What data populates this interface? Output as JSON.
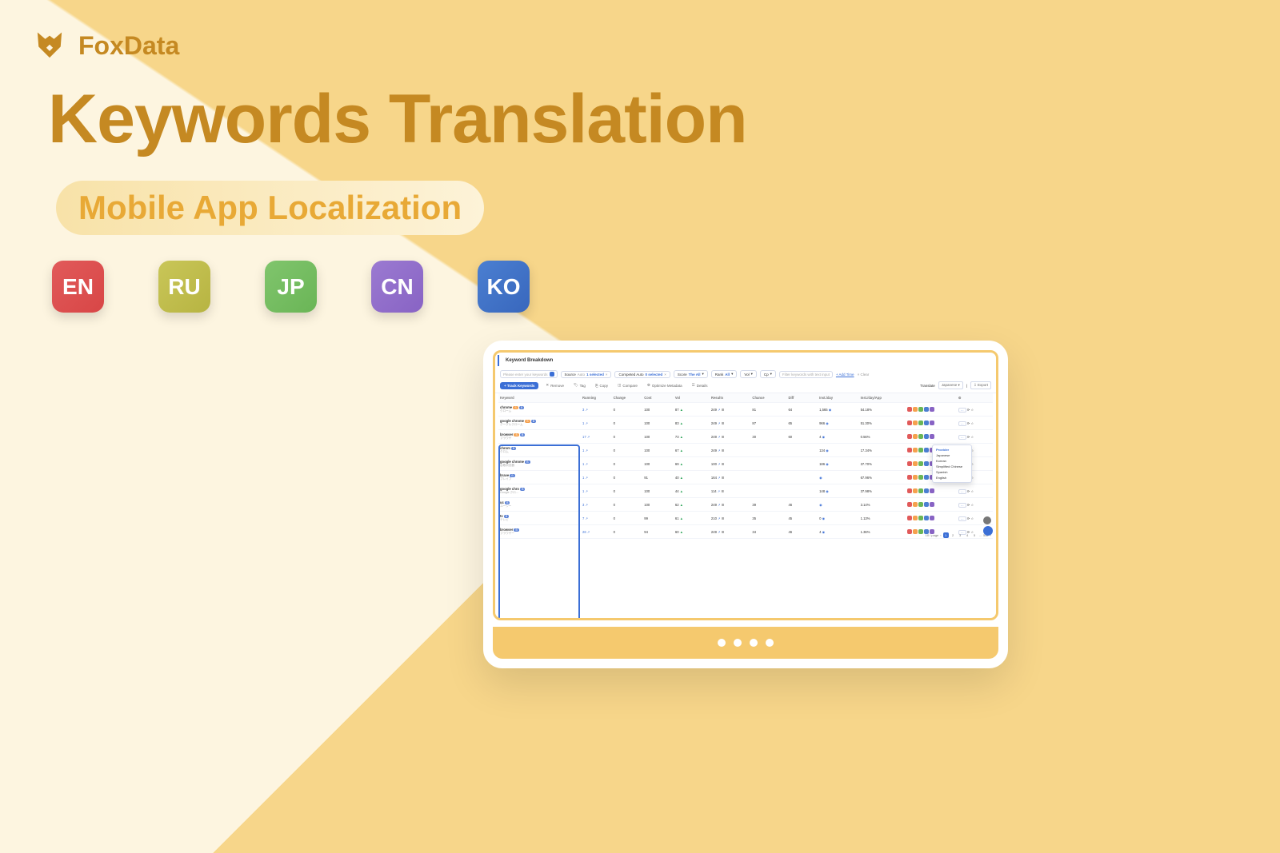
{
  "logo": {
    "text": "FoxData"
  },
  "headline": "Keywords Translation",
  "subtitle": "Mobile App Localization",
  "langs": [
    "EN",
    "RU",
    "JP",
    "CN",
    "KO"
  ],
  "app": {
    "section": "Keyword Breakdown",
    "search_ph": "Please enter your keywords",
    "filters": {
      "source": {
        "label": "Source",
        "v": "Auto",
        "picked": "1 selected"
      },
      "comp": {
        "label": "Competed Auto",
        "v": "0 selected"
      },
      "score": {
        "label": "Score",
        "v": "The All"
      },
      "rank": {
        "label": "Rank",
        "v": "All"
      },
      "vol": {
        "label": "Vol",
        "v": ""
      },
      "cp": {
        "label": "Cp",
        "v": ""
      },
      "filter_ph": "Filter keywords with text input",
      "addtime": "+ Add Time",
      "clear": "× Clear"
    },
    "tabs": {
      "track": "+ Track Keywords",
      "remove": "Remove",
      "tag": "Tag",
      "copy": "Copy",
      "compare": "Compare",
      "optimize": "Optimize Metadata",
      "details": "Details"
    },
    "right": {
      "translate": "Translate",
      "japanese": "Japanese",
      "export": "Export"
    },
    "columns": [
      "Keyword",
      "Running",
      "Change",
      "Cost",
      "Vol",
      "Results",
      "Chance",
      "Diff",
      "Inst./day",
      "Inst./day/App",
      "",
      "",
      ""
    ],
    "dropdown": {
      "hdr": "Provider",
      "items": [
        "Japanese",
        "Korean",
        "Simplified Chinese",
        "Spanish",
        "English"
      ]
    },
    "rows": [
      {
        "kw": "chrome",
        "sub": "クローム",
        "r": "3",
        "ch": "0",
        "c": "100",
        "v": "87",
        "res": "249",
        "cn": "81",
        "d": "64",
        "id": "1,565",
        "ida": "54.18%"
      },
      {
        "kw": "google chrome",
        "sub": "グーグルクローム",
        "r": "1",
        "ch": "0",
        "c": "100",
        "v": "83",
        "res": "249",
        "cn": "87",
        "d": "65",
        "id": "966",
        "ida": "51.30%"
      },
      {
        "kw": "browser",
        "sub": "ブラウザ",
        "r": "17",
        "ch": "0",
        "c": "100",
        "v": "73",
        "res": "249",
        "cn": "30",
        "d": "60",
        "id": "4",
        "ida": "0.56%"
      },
      {
        "kw": "chrom",
        "sub": "クロム",
        "r": "1",
        "ch": "0",
        "c": "100",
        "v": "67",
        "res": "249",
        "cn": "",
        "d": "",
        "id": "134",
        "ida": "17.34%"
      },
      {
        "kw": "google chrome",
        "sub": "谷歌浏览器",
        "r": "1",
        "ch": "0",
        "c": "100",
        "v": "69",
        "res": "100",
        "cn": "",
        "d": "",
        "id": "186",
        "ida": "37.70%"
      },
      {
        "kw": "brave",
        "sub": "ブレイブ",
        "r": "1",
        "ch": "0",
        "c": "91",
        "v": "40",
        "res": "164",
        "cn": "",
        "d": "",
        "id": "",
        "ida": "67.96%"
      },
      {
        "kw": "google chro",
        "sub": "Google クロ…",
        "r": "1",
        "ch": "0",
        "c": "100",
        "v": "44",
        "res": "114",
        "cn": "",
        "d": "",
        "id": "148",
        "ida": "37.98%"
      },
      {
        "kw": "uc",
        "sub": "ユーシー",
        "r": "3",
        "ch": "0",
        "c": "100",
        "v": "62",
        "res": "249",
        "cn": "39",
        "d": "46",
        "id": "",
        "ida": "3.14%"
      },
      {
        "kw": "tv",
        "sub": "テレビ",
        "r": "7",
        "ch": "0",
        "c": "99",
        "v": "61",
        "res": "210",
        "cn": "35",
        "d": "45",
        "id": "0",
        "ida": "1.13%"
      },
      {
        "kw": "browser",
        "sub": "ブラウザー",
        "r": "26",
        "ch": "0",
        "c": "94",
        "v": "60",
        "res": "249",
        "cn": "34",
        "d": "46",
        "id": "4",
        "ida": "1.36%"
      }
    ],
    "pager": {
      "label": "10 / page",
      "pages": [
        "1",
        "2",
        "3",
        "4",
        "5",
        "...",
        "552"
      ]
    }
  }
}
